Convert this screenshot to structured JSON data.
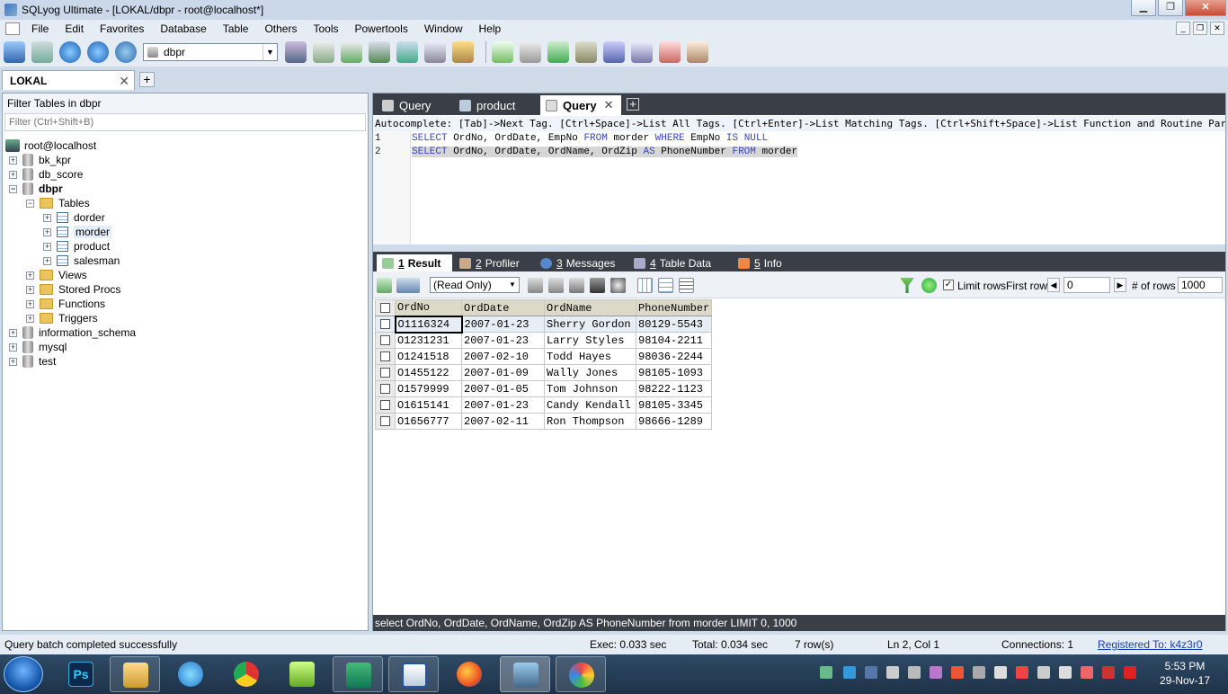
{
  "window": {
    "title": "SQLyog Ultimate - [LOKAL/dbpr - root@localhost*]"
  },
  "menu": [
    "File",
    "Edit",
    "Favorites",
    "Database",
    "Table",
    "Others",
    "Tools",
    "Powertools",
    "Window",
    "Help"
  ],
  "toolbar": {
    "db_selector": "dbpr"
  },
  "connection_tab": {
    "label": "LOKAL"
  },
  "left_panel": {
    "filter_header": "Filter Tables in dbpr",
    "filter_placeholder": "Filter (Ctrl+Shift+B)",
    "tree": {
      "root": "root@localhost",
      "dbs": [
        "bk_kpr",
        "db_score",
        "dbpr",
        "information_schema",
        "mysql",
        "test"
      ],
      "tables_folder": "Tables",
      "tables": [
        "dorder",
        "morder",
        "product",
        "salesman"
      ],
      "folders": [
        "Views",
        "Stored Procs",
        "Functions",
        "Triggers"
      ]
    }
  },
  "query_tabs": [
    {
      "label": "Query"
    },
    {
      "label": "product"
    },
    {
      "label": "Query"
    }
  ],
  "autocomplete_hint": "Autocomplete: [Tab]->Next Tag. [Ctrl+Space]->List All Tags. [Ctrl+Enter]->List Matching Tags. [Ctrl+Shift+Space]->List Function and Routine Parameters.",
  "editor": {
    "line_numbers": [
      "1",
      "2"
    ],
    "line1": {
      "t1": "SELECT",
      "t2": " OrdNo, OrdDate, EmpNo ",
      "t3": "FROM",
      "t4": " morder ",
      "t5": "WHERE",
      "t6": " EmpNo ",
      "t7": "IS NULL"
    },
    "line2": {
      "t1": "SELECT",
      "t2": " OrdNo, OrdDate, OrdName, OrdZip ",
      "t3": "AS",
      "t4": " PhoneNumber ",
      "t5": "FROM",
      "t6": " morder"
    }
  },
  "result_tabs": [
    {
      "num": "1",
      "label": "Result"
    },
    {
      "num": "2",
      "label": "Profiler"
    },
    {
      "num": "3",
      "label": "Messages"
    },
    {
      "num": "4",
      "label": "Table Data"
    },
    {
      "num": "5",
      "label": "Info"
    }
  ],
  "result_toolbar": {
    "mode": "(Read Only)",
    "limit_rows": "Limit rows",
    "first_row_label": "First row",
    "first_row_value": "0",
    "num_rows_label": "# of rows",
    "num_rows_value": "1000"
  },
  "grid": {
    "columns": [
      "OrdNo",
      "OrdDate",
      "OrdName",
      "PhoneNumber"
    ],
    "rows": [
      [
        "O1116324",
        "2007-01-23",
        "Sherry Gordon",
        "80129-5543"
      ],
      [
        "O1231231",
        "2007-01-23",
        "Larry Styles",
        "98104-2211"
      ],
      [
        "O1241518",
        "2007-02-10",
        "Todd Hayes",
        "98036-2244"
      ],
      [
        "O1455122",
        "2007-01-09",
        "Wally Jones",
        "98105-1093"
      ],
      [
        "O1579999",
        "2007-01-05",
        "Tom Johnson",
        "98222-1123"
      ],
      [
        "O1615141",
        "2007-01-23",
        "Candy Kendall",
        "98105-3345"
      ],
      [
        "O1656777",
        "2007-02-11",
        "Ron Thompson",
        "98666-1289"
      ]
    ]
  },
  "sql_bar": "select OrdNo, OrdDate, OrdName, OrdZip AS PhoneNumber from morder LIMIT 0, 1000",
  "status": {
    "message": "Query batch completed successfully",
    "exec": "Exec: 0.033 sec",
    "total": "Total: 0.034 sec",
    "rows": "7 row(s)",
    "pos": "Ln 2, Col 1",
    "connections": "Connections: 1",
    "registered": "Registered To: k4z3r0"
  },
  "taskbar": {
    "time": "5:53 PM",
    "date": "29-Nov-17",
    "ps_label": "Ps"
  }
}
